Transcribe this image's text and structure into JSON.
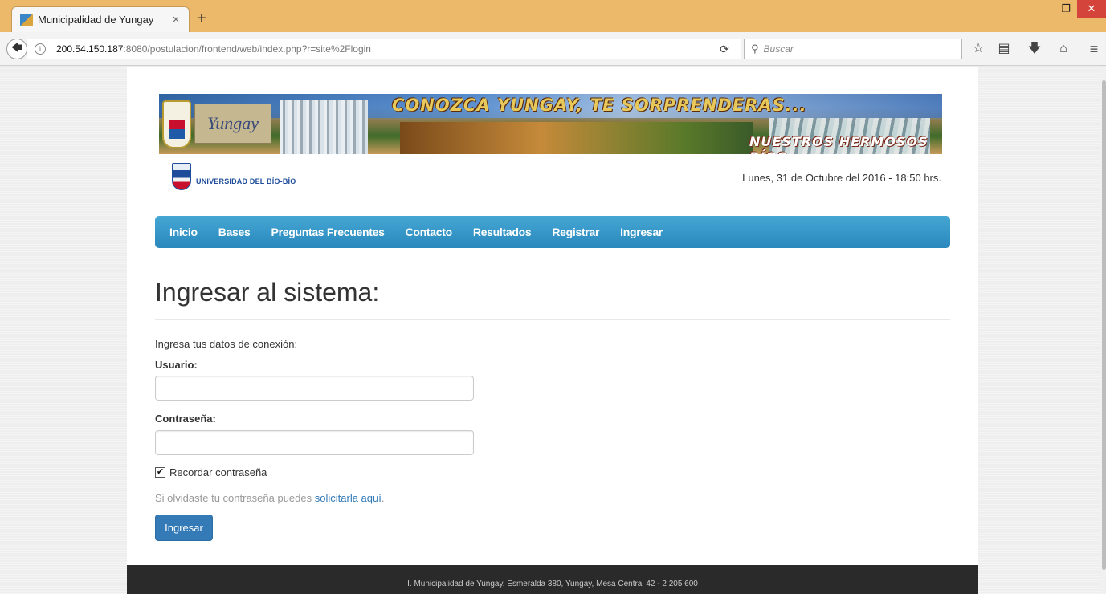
{
  "browser": {
    "tab_title": "Municipalidad de Yungay",
    "tab_close": "×",
    "new_tab": "+",
    "url_host": "200.54.150.187",
    "url_rest": ":8080/postulacion/frontend/web/index.php?r=site%2Flogin",
    "search_placeholder": "Buscar",
    "icons": [
      "back-icon",
      "info-icon",
      "reload-icon",
      "search-icon",
      "star-icon",
      "reading-list-icon",
      "download-icon",
      "home-icon",
      "menu-icon"
    ]
  },
  "banner": {
    "headline": "CONOZCA YUNGAY, TE SORPRENDERAS...",
    "subline": "NUESTROS HERMOSOS RÍOS",
    "logo_text": "Yungay"
  },
  "header": {
    "university": "UNIVERSIDAD DEL BÍO-BÍO",
    "datetime": "Lunes, 31 de Octubre del 2016 - 18:50 hrs."
  },
  "nav": {
    "items": [
      {
        "label": "Inicio"
      },
      {
        "label": "Bases"
      },
      {
        "label": "Preguntas Frecuentes"
      },
      {
        "label": "Contacto"
      },
      {
        "label": "Resultados"
      },
      {
        "label": "Registrar"
      },
      {
        "label": "Ingresar"
      }
    ]
  },
  "login": {
    "title": "Ingresar al sistema:",
    "intro": "Ingresa tus datos de conexión:",
    "user_label": "Usuario:",
    "user_value": "",
    "pass_label": "Contraseña:",
    "pass_value": "",
    "remember_label": "Recordar contraseña",
    "remember_checked": true,
    "forgot_text": "Si olvidaste tu contraseña puedes ",
    "forgot_link": "solicitarla aquí",
    "forgot_end": ".",
    "submit_label": "Ingresar"
  },
  "footer": {
    "text": "I. Municipalidad de Yungay. Esmeralda 380, Yungay, Mesa Central 42 - 2 205 600"
  },
  "colors": {
    "titlebar": "#ecb96a",
    "nav_blue": "#2a88bd",
    "button_blue": "#337ab7",
    "footer_bg": "#2a2a2a",
    "close_red": "#d4443a"
  }
}
